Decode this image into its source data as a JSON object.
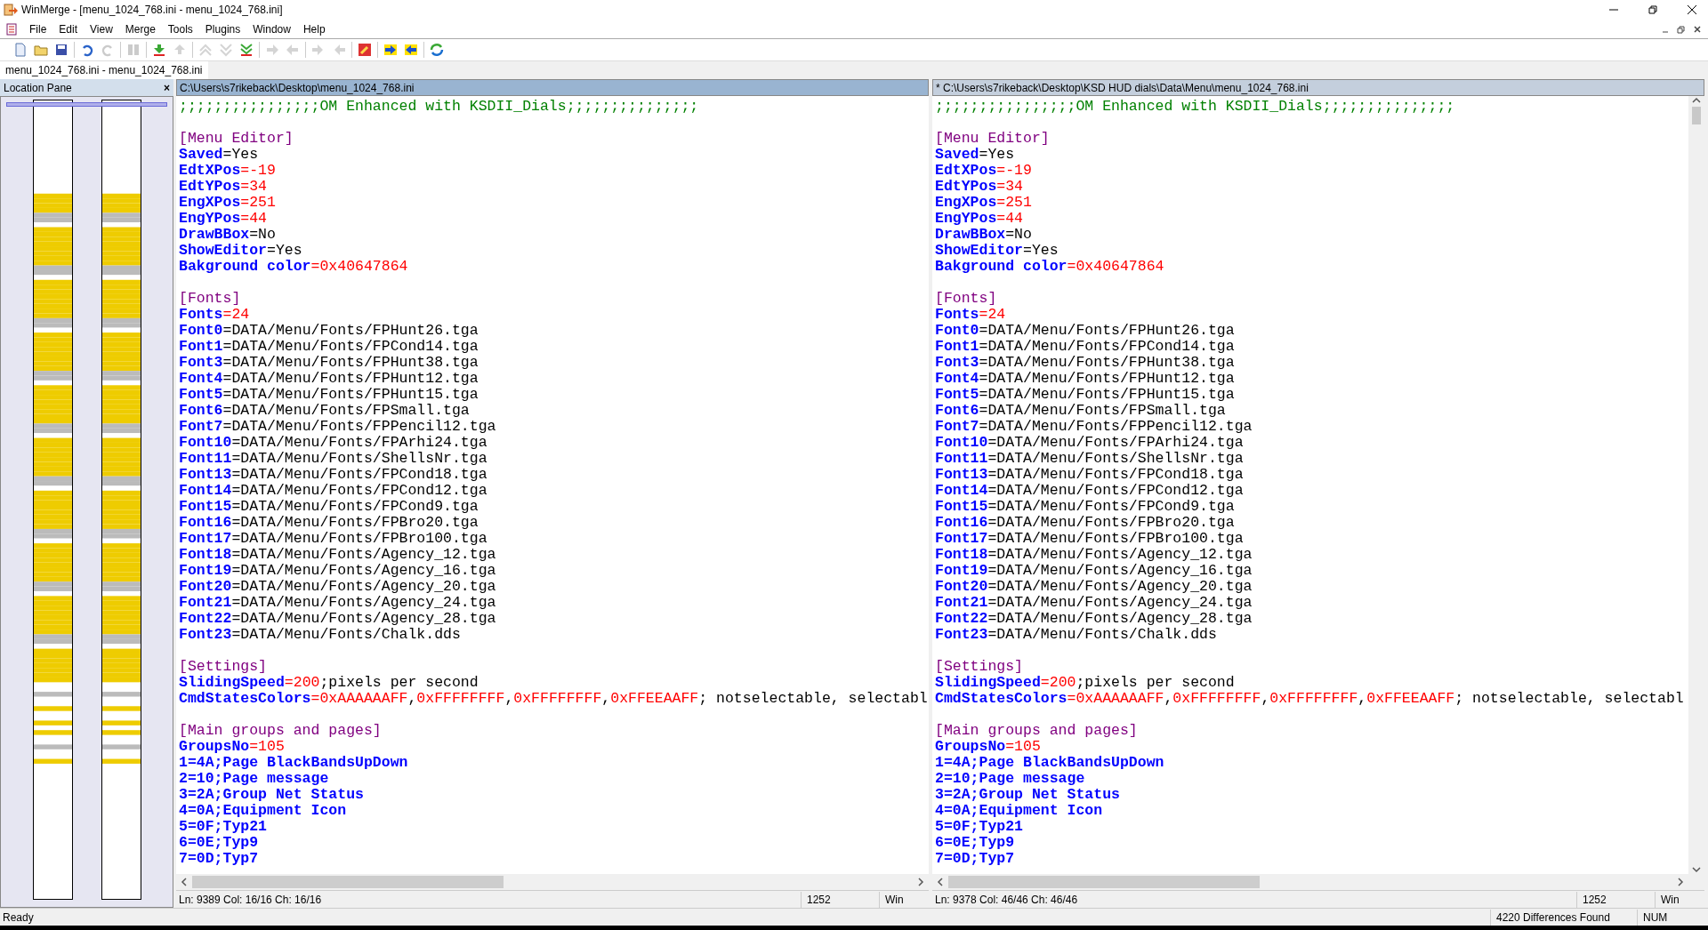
{
  "window": {
    "title": "WinMerge - [menu_1024_768.ini - menu_1024_768.ini]"
  },
  "menu": [
    "File",
    "Edit",
    "View",
    "Merge",
    "Tools",
    "Plugins",
    "Window",
    "Help"
  ],
  "tabs": [
    {
      "label": "menu_1024_768.ini - menu_1024_768.ini",
      "selected": true
    }
  ],
  "location_pane": {
    "title": "Location Pane",
    "close": "×"
  },
  "panes": [
    {
      "path": "C:\\Users\\s7rikeback\\Desktop\\menu_1024_768.ini",
      "selected": true,
      "lines": [
        {
          "kind": "code",
          "tokens": [
            {
              "kind": "comment",
              "text": ";;;;;;;;;;;;;;;;OM Enhanced with KSDII_Dials;;;;;;;;;;;;;;;"
            }
          ]
        },
        {
          "kind": "blank"
        },
        {
          "kind": "code",
          "tokens": [
            {
              "kind": "section",
              "text": "[Menu Editor]"
            }
          ]
        },
        {
          "kind": "code",
          "tokens": [
            {
              "kind": "key",
              "text": "Saved"
            },
            {
              "kind": "text",
              "text": "=Yes"
            }
          ]
        },
        {
          "kind": "code",
          "tokens": [
            {
              "kind": "key",
              "text": "EdtXPos"
            },
            {
              "kind": "number",
              "text": "=-19"
            }
          ]
        },
        {
          "kind": "code",
          "tokens": [
            {
              "kind": "key",
              "text": "EdtYPos"
            },
            {
              "kind": "number",
              "text": "=34"
            }
          ]
        },
        {
          "kind": "code",
          "tokens": [
            {
              "kind": "key",
              "text": "EngXPos"
            },
            {
              "kind": "number",
              "text": "=251"
            }
          ]
        },
        {
          "kind": "code",
          "tokens": [
            {
              "kind": "key",
              "text": "EngYPos"
            },
            {
              "kind": "number",
              "text": "=44"
            }
          ]
        },
        {
          "kind": "code",
          "tokens": [
            {
              "kind": "key",
              "text": "DrawBBox"
            },
            {
              "kind": "text",
              "text": "=No"
            }
          ]
        },
        {
          "kind": "code",
          "tokens": [
            {
              "kind": "key",
              "text": "ShowEditor"
            },
            {
              "kind": "text",
              "text": "=Yes"
            }
          ]
        },
        {
          "kind": "code",
          "tokens": [
            {
              "kind": "key",
              "text": "Bakground color"
            },
            {
              "kind": "number",
              "text": "=0x40647864"
            }
          ]
        },
        {
          "kind": "blank"
        },
        {
          "kind": "code",
          "tokens": [
            {
              "kind": "section",
              "text": "[Fonts]"
            }
          ]
        },
        {
          "kind": "code",
          "tokens": [
            {
              "kind": "key",
              "text": "Fonts"
            },
            {
              "kind": "number",
              "text": "=24"
            }
          ]
        },
        {
          "kind": "code",
          "tokens": [
            {
              "kind": "key",
              "text": "Font0"
            },
            {
              "kind": "text",
              "text": "=DATA/Menu/Fonts/FPHunt26.tga"
            }
          ]
        },
        {
          "kind": "code",
          "tokens": [
            {
              "kind": "key",
              "text": "Font1"
            },
            {
              "kind": "text",
              "text": "=DATA/Menu/Fonts/FPCond14.tga"
            }
          ]
        },
        {
          "kind": "code",
          "tokens": [
            {
              "kind": "key",
              "text": "Font3"
            },
            {
              "kind": "text",
              "text": "=DATA/Menu/Fonts/FPHunt38.tga"
            }
          ]
        },
        {
          "kind": "code",
          "tokens": [
            {
              "kind": "key",
              "text": "Font4"
            },
            {
              "kind": "text",
              "text": "=DATA/Menu/Fonts/FPHunt12.tga"
            }
          ]
        },
        {
          "kind": "code",
          "tokens": [
            {
              "kind": "key",
              "text": "Font5"
            },
            {
              "kind": "text",
              "text": "=DATA/Menu/Fonts/FPHunt15.tga"
            }
          ]
        },
        {
          "kind": "code",
          "tokens": [
            {
              "kind": "key",
              "text": "Font6"
            },
            {
              "kind": "text",
              "text": "=DATA/Menu/Fonts/FPSmall.tga"
            }
          ]
        },
        {
          "kind": "code",
          "tokens": [
            {
              "kind": "key",
              "text": "Font7"
            },
            {
              "kind": "text",
              "text": "=DATA/Menu/Fonts/FPPencil12.tga"
            }
          ]
        },
        {
          "kind": "code",
          "tokens": [
            {
              "kind": "key",
              "text": "Font10"
            },
            {
              "kind": "text",
              "text": "=DATA/Menu/Fonts/FPArhi24.tga"
            }
          ]
        },
        {
          "kind": "code",
          "tokens": [
            {
              "kind": "key",
              "text": "Font11"
            },
            {
              "kind": "text",
              "text": "=DATA/Menu/Fonts/ShellsNr.tga"
            }
          ]
        },
        {
          "kind": "code",
          "tokens": [
            {
              "kind": "key",
              "text": "Font13"
            },
            {
              "kind": "text",
              "text": "=DATA/Menu/Fonts/FPCond18.tga"
            }
          ]
        },
        {
          "kind": "code",
          "tokens": [
            {
              "kind": "key",
              "text": "Font14"
            },
            {
              "kind": "text",
              "text": "=DATA/Menu/Fonts/FPCond12.tga"
            }
          ]
        },
        {
          "kind": "code",
          "tokens": [
            {
              "kind": "key",
              "text": "Font15"
            },
            {
              "kind": "text",
              "text": "=DATA/Menu/Fonts/FPCond9.tga"
            }
          ]
        },
        {
          "kind": "code",
          "tokens": [
            {
              "kind": "key",
              "text": "Font16"
            },
            {
              "kind": "text",
              "text": "=DATA/Menu/Fonts/FPBro20.tga"
            }
          ]
        },
        {
          "kind": "code",
          "tokens": [
            {
              "kind": "key",
              "text": "Font17"
            },
            {
              "kind": "text",
              "text": "=DATA/Menu/Fonts/FPBro100.tga"
            }
          ]
        },
        {
          "kind": "code",
          "tokens": [
            {
              "kind": "key",
              "text": "Font18"
            },
            {
              "kind": "text",
              "text": "=DATA/Menu/Fonts/Agency_12.tga"
            }
          ]
        },
        {
          "kind": "code",
          "tokens": [
            {
              "kind": "key",
              "text": "Font19"
            },
            {
              "kind": "text",
              "text": "=DATA/Menu/Fonts/Agency_16.tga"
            }
          ]
        },
        {
          "kind": "code",
          "tokens": [
            {
              "kind": "key",
              "text": "Font20"
            },
            {
              "kind": "text",
              "text": "=DATA/Menu/Fonts/Agency_20.tga"
            }
          ]
        },
        {
          "kind": "code",
          "tokens": [
            {
              "kind": "key",
              "text": "Font21"
            },
            {
              "kind": "text",
              "text": "=DATA/Menu/Fonts/Agency_24.tga"
            }
          ]
        },
        {
          "kind": "code",
          "tokens": [
            {
              "kind": "key",
              "text": "Font22"
            },
            {
              "kind": "text",
              "text": "=DATA/Menu/Fonts/Agency_28.tga"
            }
          ]
        },
        {
          "kind": "code",
          "tokens": [
            {
              "kind": "key",
              "text": "Font23"
            },
            {
              "kind": "text",
              "text": "=DATA/Menu/Fonts/Chalk.dds"
            }
          ]
        },
        {
          "kind": "blank"
        },
        {
          "kind": "code",
          "tokens": [
            {
              "kind": "section",
              "text": "[Settings]"
            }
          ]
        },
        {
          "kind": "code",
          "tokens": [
            {
              "kind": "key",
              "text": "SlidingSpeed"
            },
            {
              "kind": "number",
              "text": "=200"
            },
            {
              "kind": "text",
              "text": ";pixels per second"
            }
          ]
        },
        {
          "kind": "code",
          "tokens": [
            {
              "kind": "key",
              "text": "CmdStatesColors"
            },
            {
              "kind": "number",
              "text": "=0xAAAAAAFF"
            },
            {
              "kind": "text",
              "text": ","
            },
            {
              "kind": "number",
              "text": "0xFFFFFFFF"
            },
            {
              "kind": "text",
              "text": ","
            },
            {
              "kind": "number",
              "text": "0xFFFFFFFF"
            },
            {
              "kind": "text",
              "text": ","
            },
            {
              "kind": "number",
              "text": "0xFFEEAAFF"
            },
            {
              "kind": "text",
              "text": "; notselectable, selectabl"
            }
          ]
        },
        {
          "kind": "blank"
        },
        {
          "kind": "code",
          "tokens": [
            {
              "kind": "section",
              "text": "[Main groups and pages]"
            }
          ]
        },
        {
          "kind": "code",
          "tokens": [
            {
              "kind": "key",
              "text": "GroupsNo"
            },
            {
              "kind": "number",
              "text": "=105"
            }
          ]
        },
        {
          "kind": "code",
          "tokens": [
            {
              "kind": "key",
              "text": "1=4A;Page BlackBandsUpDown"
            }
          ]
        },
        {
          "kind": "code",
          "tokens": [
            {
              "kind": "key",
              "text": "2=10;Page message"
            }
          ]
        },
        {
          "kind": "code",
          "tokens": [
            {
              "kind": "key",
              "text": "3=2A;Group Net Status"
            }
          ]
        },
        {
          "kind": "code",
          "tokens": [
            {
              "kind": "key",
              "text": "4=0A;Equipment Icon"
            }
          ]
        },
        {
          "kind": "code",
          "tokens": [
            {
              "kind": "key",
              "text": "5=0F;Typ21"
            }
          ]
        },
        {
          "kind": "code",
          "tokens": [
            {
              "kind": "key",
              "text": "6=0E;Typ9"
            }
          ]
        },
        {
          "kind": "code",
          "tokens": [
            {
              "kind": "key",
              "text": "7=0D;Typ7"
            }
          ]
        }
      ],
      "status": {
        "position": "Ln: 9389  Col: 16/16  Ch: 16/16",
        "codepage": "1252",
        "eol": "Win"
      }
    },
    {
      "path": "* C:\\Users\\s7rikeback\\Desktop\\KSD HUD dials\\Data\\Menu\\menu_1024_768.ini",
      "selected": false,
      "lines": [
        {
          "kind": "code",
          "tokens": [
            {
              "kind": "comment",
              "text": ";;;;;;;;;;;;;;;;OM Enhanced with KSDII_Dials;;;;;;;;;;;;;;;"
            }
          ]
        },
        {
          "kind": "blank"
        },
        {
          "kind": "code",
          "tokens": [
            {
              "kind": "section",
              "text": "[Menu Editor]"
            }
          ]
        },
        {
          "kind": "code",
          "tokens": [
            {
              "kind": "key",
              "text": "Saved"
            },
            {
              "kind": "text",
              "text": "=Yes"
            }
          ]
        },
        {
          "kind": "code",
          "tokens": [
            {
              "kind": "key",
              "text": "EdtXPos"
            },
            {
              "kind": "number",
              "text": "=-19"
            }
          ]
        },
        {
          "kind": "code",
          "tokens": [
            {
              "kind": "key",
              "text": "EdtYPos"
            },
            {
              "kind": "number",
              "text": "=34"
            }
          ]
        },
        {
          "kind": "code",
          "tokens": [
            {
              "kind": "key",
              "text": "EngXPos"
            },
            {
              "kind": "number",
              "text": "=251"
            }
          ]
        },
        {
          "kind": "code",
          "tokens": [
            {
              "kind": "key",
              "text": "EngYPos"
            },
            {
              "kind": "number",
              "text": "=44"
            }
          ]
        },
        {
          "kind": "code",
          "tokens": [
            {
              "kind": "key",
              "text": "DrawBBox"
            },
            {
              "kind": "text",
              "text": "=No"
            }
          ]
        },
        {
          "kind": "code",
          "tokens": [
            {
              "kind": "key",
              "text": "ShowEditor"
            },
            {
              "kind": "text",
              "text": "=Yes"
            }
          ]
        },
        {
          "kind": "code",
          "tokens": [
            {
              "kind": "key",
              "text": "Bakground color"
            },
            {
              "kind": "number",
              "text": "=0x40647864"
            }
          ]
        },
        {
          "kind": "blank"
        },
        {
          "kind": "code",
          "tokens": [
            {
              "kind": "section",
              "text": "[Fonts]"
            }
          ]
        },
        {
          "kind": "code",
          "tokens": [
            {
              "kind": "key",
              "text": "Fonts"
            },
            {
              "kind": "number",
              "text": "=24"
            }
          ]
        },
        {
          "kind": "code",
          "tokens": [
            {
              "kind": "key",
              "text": "Font0"
            },
            {
              "kind": "text",
              "text": "=DATA/Menu/Fonts/FPHunt26.tga"
            }
          ]
        },
        {
          "kind": "code",
          "tokens": [
            {
              "kind": "key",
              "text": "Font1"
            },
            {
              "kind": "text",
              "text": "=DATA/Menu/Fonts/FPCond14.tga"
            }
          ]
        },
        {
          "kind": "code",
          "tokens": [
            {
              "kind": "key",
              "text": "Font3"
            },
            {
              "kind": "text",
              "text": "=DATA/Menu/Fonts/FPHunt38.tga"
            }
          ]
        },
        {
          "kind": "code",
          "tokens": [
            {
              "kind": "key",
              "text": "Font4"
            },
            {
              "kind": "text",
              "text": "=DATA/Menu/Fonts/FPHunt12.tga"
            }
          ]
        },
        {
          "kind": "code",
          "tokens": [
            {
              "kind": "key",
              "text": "Font5"
            },
            {
              "kind": "text",
              "text": "=DATA/Menu/Fonts/FPHunt15.tga"
            }
          ]
        },
        {
          "kind": "code",
          "tokens": [
            {
              "kind": "key",
              "text": "Font6"
            },
            {
              "kind": "text",
              "text": "=DATA/Menu/Fonts/FPSmall.tga"
            }
          ]
        },
        {
          "kind": "code",
          "tokens": [
            {
              "kind": "key",
              "text": "Font7"
            },
            {
              "kind": "text",
              "text": "=DATA/Menu/Fonts/FPPencil12.tga"
            }
          ]
        },
        {
          "kind": "code",
          "tokens": [
            {
              "kind": "key",
              "text": "Font10"
            },
            {
              "kind": "text",
              "text": "=DATA/Menu/Fonts/FPArhi24.tga"
            }
          ]
        },
        {
          "kind": "code",
          "tokens": [
            {
              "kind": "key",
              "text": "Font11"
            },
            {
              "kind": "text",
              "text": "=DATA/Menu/Fonts/ShellsNr.tga"
            }
          ]
        },
        {
          "kind": "code",
          "tokens": [
            {
              "kind": "key",
              "text": "Font13"
            },
            {
              "kind": "text",
              "text": "=DATA/Menu/Fonts/FPCond18.tga"
            }
          ]
        },
        {
          "kind": "code",
          "tokens": [
            {
              "kind": "key",
              "text": "Font14"
            },
            {
              "kind": "text",
              "text": "=DATA/Menu/Fonts/FPCond12.tga"
            }
          ]
        },
        {
          "kind": "code",
          "tokens": [
            {
              "kind": "key",
              "text": "Font15"
            },
            {
              "kind": "text",
              "text": "=DATA/Menu/Fonts/FPCond9.tga"
            }
          ]
        },
        {
          "kind": "code",
          "tokens": [
            {
              "kind": "key",
              "text": "Font16"
            },
            {
              "kind": "text",
              "text": "=DATA/Menu/Fonts/FPBro20.tga"
            }
          ]
        },
        {
          "kind": "code",
          "tokens": [
            {
              "kind": "key",
              "text": "Font17"
            },
            {
              "kind": "text",
              "text": "=DATA/Menu/Fonts/FPBro100.tga"
            }
          ]
        },
        {
          "kind": "code",
          "tokens": [
            {
              "kind": "key",
              "text": "Font18"
            },
            {
              "kind": "text",
              "text": "=DATA/Menu/Fonts/Agency_12.tga"
            }
          ]
        },
        {
          "kind": "code",
          "tokens": [
            {
              "kind": "key",
              "text": "Font19"
            },
            {
              "kind": "text",
              "text": "=DATA/Menu/Fonts/Agency_16.tga"
            }
          ]
        },
        {
          "kind": "code",
          "tokens": [
            {
              "kind": "key",
              "text": "Font20"
            },
            {
              "kind": "text",
              "text": "=DATA/Menu/Fonts/Agency_20.tga"
            }
          ]
        },
        {
          "kind": "code",
          "tokens": [
            {
              "kind": "key",
              "text": "Font21"
            },
            {
              "kind": "text",
              "text": "=DATA/Menu/Fonts/Agency_24.tga"
            }
          ]
        },
        {
          "kind": "code",
          "tokens": [
            {
              "kind": "key",
              "text": "Font22"
            },
            {
              "kind": "text",
              "text": "=DATA/Menu/Fonts/Agency_28.tga"
            }
          ]
        },
        {
          "kind": "code",
          "tokens": [
            {
              "kind": "key",
              "text": "Font23"
            },
            {
              "kind": "text",
              "text": "=DATA/Menu/Fonts/Chalk.dds"
            }
          ]
        },
        {
          "kind": "blank"
        },
        {
          "kind": "code",
          "tokens": [
            {
              "kind": "section",
              "text": "[Settings]"
            }
          ]
        },
        {
          "kind": "code",
          "tokens": [
            {
              "kind": "key",
              "text": "SlidingSpeed"
            },
            {
              "kind": "number",
              "text": "=200"
            },
            {
              "kind": "text",
              "text": ";pixels per second"
            }
          ]
        },
        {
          "kind": "code",
          "tokens": [
            {
              "kind": "key",
              "text": "CmdStatesColors"
            },
            {
              "kind": "number",
              "text": "=0xAAAAAAFF"
            },
            {
              "kind": "text",
              "text": ","
            },
            {
              "kind": "number",
              "text": "0xFFFFFFFF"
            },
            {
              "kind": "text",
              "text": ","
            },
            {
              "kind": "number",
              "text": "0xFFFFFFFF"
            },
            {
              "kind": "text",
              "text": ","
            },
            {
              "kind": "number",
              "text": "0xFFEEAAFF"
            },
            {
              "kind": "text",
              "text": "; notselectable, selectabl"
            }
          ]
        },
        {
          "kind": "blank"
        },
        {
          "kind": "code",
          "tokens": [
            {
              "kind": "section",
              "text": "[Main groups and pages]"
            }
          ]
        },
        {
          "kind": "code",
          "tokens": [
            {
              "kind": "key",
              "text": "GroupsNo"
            },
            {
              "kind": "number",
              "text": "=105"
            }
          ]
        },
        {
          "kind": "code",
          "tokens": [
            {
              "kind": "key",
              "text": "1=4A;Page BlackBandsUpDown"
            }
          ]
        },
        {
          "kind": "code",
          "tokens": [
            {
              "kind": "key",
              "text": "2=10;Page message"
            }
          ]
        },
        {
          "kind": "code",
          "tokens": [
            {
              "kind": "key",
              "text": "3=2A;Group Net Status"
            }
          ]
        },
        {
          "kind": "code",
          "tokens": [
            {
              "kind": "key",
              "text": "4=0A;Equipment Icon"
            }
          ]
        },
        {
          "kind": "code",
          "tokens": [
            {
              "kind": "key",
              "text": "5=0F;Typ21"
            }
          ]
        },
        {
          "kind": "code",
          "tokens": [
            {
              "kind": "key",
              "text": "6=0E;Typ9"
            }
          ]
        },
        {
          "kind": "code",
          "tokens": [
            {
              "kind": "key",
              "text": "7=0D;Typ7"
            }
          ]
        }
      ],
      "status": {
        "position": "Ln: 9378  Col: 46/46  Ch: 46/46",
        "codepage": "1252",
        "eol": "Win"
      }
    }
  ],
  "status_bar": {
    "message": "Ready",
    "differences": "4220 Differences Found",
    "indicator": "NUM"
  }
}
